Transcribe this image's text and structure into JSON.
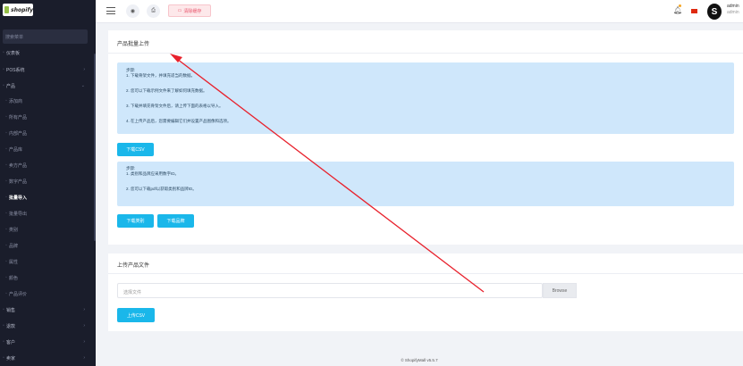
{
  "sidebar": {
    "logo_text": "shopify",
    "search_placeholder": "搜索菜单",
    "items": [
      {
        "label": "仪表板",
        "icon": "dashboard-icon"
      },
      {
        "label": "POS系统",
        "icon": "pos-icon"
      },
      {
        "label": "产品",
        "icon": "product-icon"
      },
      {
        "label": "添加商",
        "icon": "dot-icon"
      },
      {
        "label": "所有产品",
        "icon": "dot-icon"
      },
      {
        "label": "内部产品",
        "icon": "dot-icon"
      },
      {
        "label": "产品库",
        "icon": "dot-icon"
      },
      {
        "label": "卖方产品",
        "icon": "dot-icon"
      },
      {
        "label": "数字产品",
        "icon": "dot-icon"
      },
      {
        "label": "批量导入",
        "icon": "dot-icon"
      },
      {
        "label": "批量导出",
        "icon": "dot-icon"
      },
      {
        "label": "类别",
        "icon": "dot-icon"
      },
      {
        "label": "品牌",
        "icon": "dot-icon"
      },
      {
        "label": "属性",
        "icon": "dot-icon"
      },
      {
        "label": "颜色",
        "icon": "dot-icon"
      },
      {
        "label": "产品评价",
        "icon": "dot-icon"
      },
      {
        "label": "销售",
        "icon": "sales-icon"
      },
      {
        "label": "退款",
        "icon": "refund-icon"
      },
      {
        "label": "客户",
        "icon": "customer-icon"
      },
      {
        "label": "卖家",
        "icon": "seller-icon"
      }
    ]
  },
  "topbar": {
    "clear_cache_label": "清除缓存",
    "user_name": "admin",
    "user_role": "admin",
    "avatar_letter": "S"
  },
  "card1": {
    "title": "产品批量上传",
    "info1": {
      "heading": "步骤:",
      "steps": [
        "1. 下载骨架文件，并填充适当的数据。",
        "2. 您可以下载示例文件来了解如何填充数据。",
        "3. 下载并填充骨架文件后，请上传下面的表格以导入。",
        "4. 在上传产品后，您需要编辑它们并设置产品图像和选项。"
      ]
    },
    "download_csv_label": "下载CSV",
    "info2": {
      "heading": "步骤:",
      "steps": [
        "1. 类别和品牌应采用数字ID。",
        "2. 您可以下载pdf以获取类别和品牌ID。"
      ]
    },
    "download_category_label": "下载类别",
    "download_brand_label": "下载品牌"
  },
  "card2": {
    "title": "上传产品文件",
    "file_placeholder": "选择文件",
    "browse_label": "Browse",
    "upload_label": "上传CSV"
  },
  "footer": "© ShopifyMall v5.5.7",
  "colors": {
    "sidebar_bg": "#1a1d2b",
    "accent": "#1ab7ea",
    "info_bg": "#cfe7fb",
    "annotation_arrow": "#e8212c"
  }
}
